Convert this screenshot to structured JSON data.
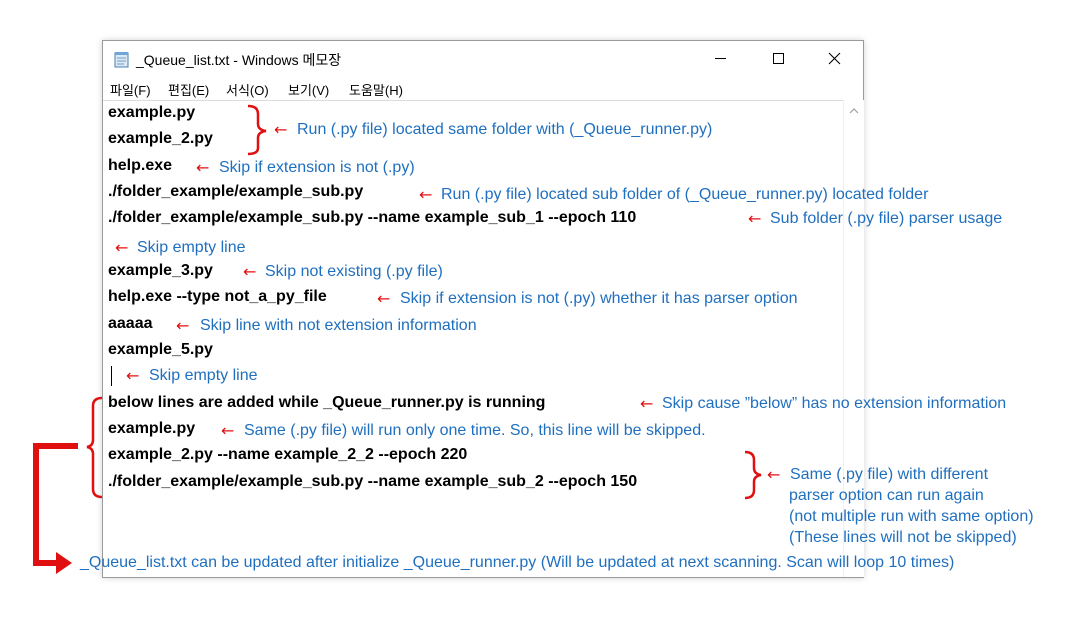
{
  "window": {
    "title": "_Queue_list.txt - Windows 메모장",
    "menu": [
      "파일(F)",
      "편집(E)",
      "서식(O)",
      "보기(V)",
      "도움말(H)"
    ]
  },
  "lines": [
    "example.py",
    "example_2.py",
    "help.exe",
    "./folder_example/example_sub.py",
    "./folder_example/example_sub.py --name example_sub_1 --epoch 110",
    "",
    "example_3.py",
    "help.exe --type not_a_py_file",
    "aaaaa",
    "example_5.py",
    "",
    "below lines are added while _Queue_runner.py is running",
    "example.py",
    "example_2.py --name example_2_2 --epoch 220",
    "./folder_example/example_sub.py --name example_sub_2 --epoch 150"
  ],
  "annotations": {
    "arrow": "←",
    "run_same_folder": "Run (.py file) located same folder with (_Queue_runner.py)",
    "skip_not_py": "Skip if extension is not (.py)",
    "run_sub_folder": "Run (.py file) located sub folder of (_Queue_runner.py) located folder",
    "parser_usage": "Sub folder (.py file) parser usage",
    "skip_empty_1": "Skip empty line",
    "skip_not_existing": "Skip not existing (.py file)",
    "skip_not_py_parser": "Skip if extension is not (.py) whether it has parser option",
    "skip_no_ext": "Skip line with not extension information",
    "skip_empty_2": "Skip empty line",
    "skip_below": "Skip cause ”below” has no extension information",
    "same_run_once": "Same (.py file) will run only one time. So, this line will be skipped.",
    "same_diff_options": [
      "Same (.py file) with different",
      "parser option can run again",
      "(not multiple run with same option)",
      "(These lines will not be skipped)"
    ],
    "footer": "_Queue_list.txt can be updated after initialize _Queue_runner.py (Will be updated at next scanning. Scan will loop 10 times)"
  },
  "colors": {
    "annotation": "#1f6fbf",
    "arrow": "#e01010"
  }
}
